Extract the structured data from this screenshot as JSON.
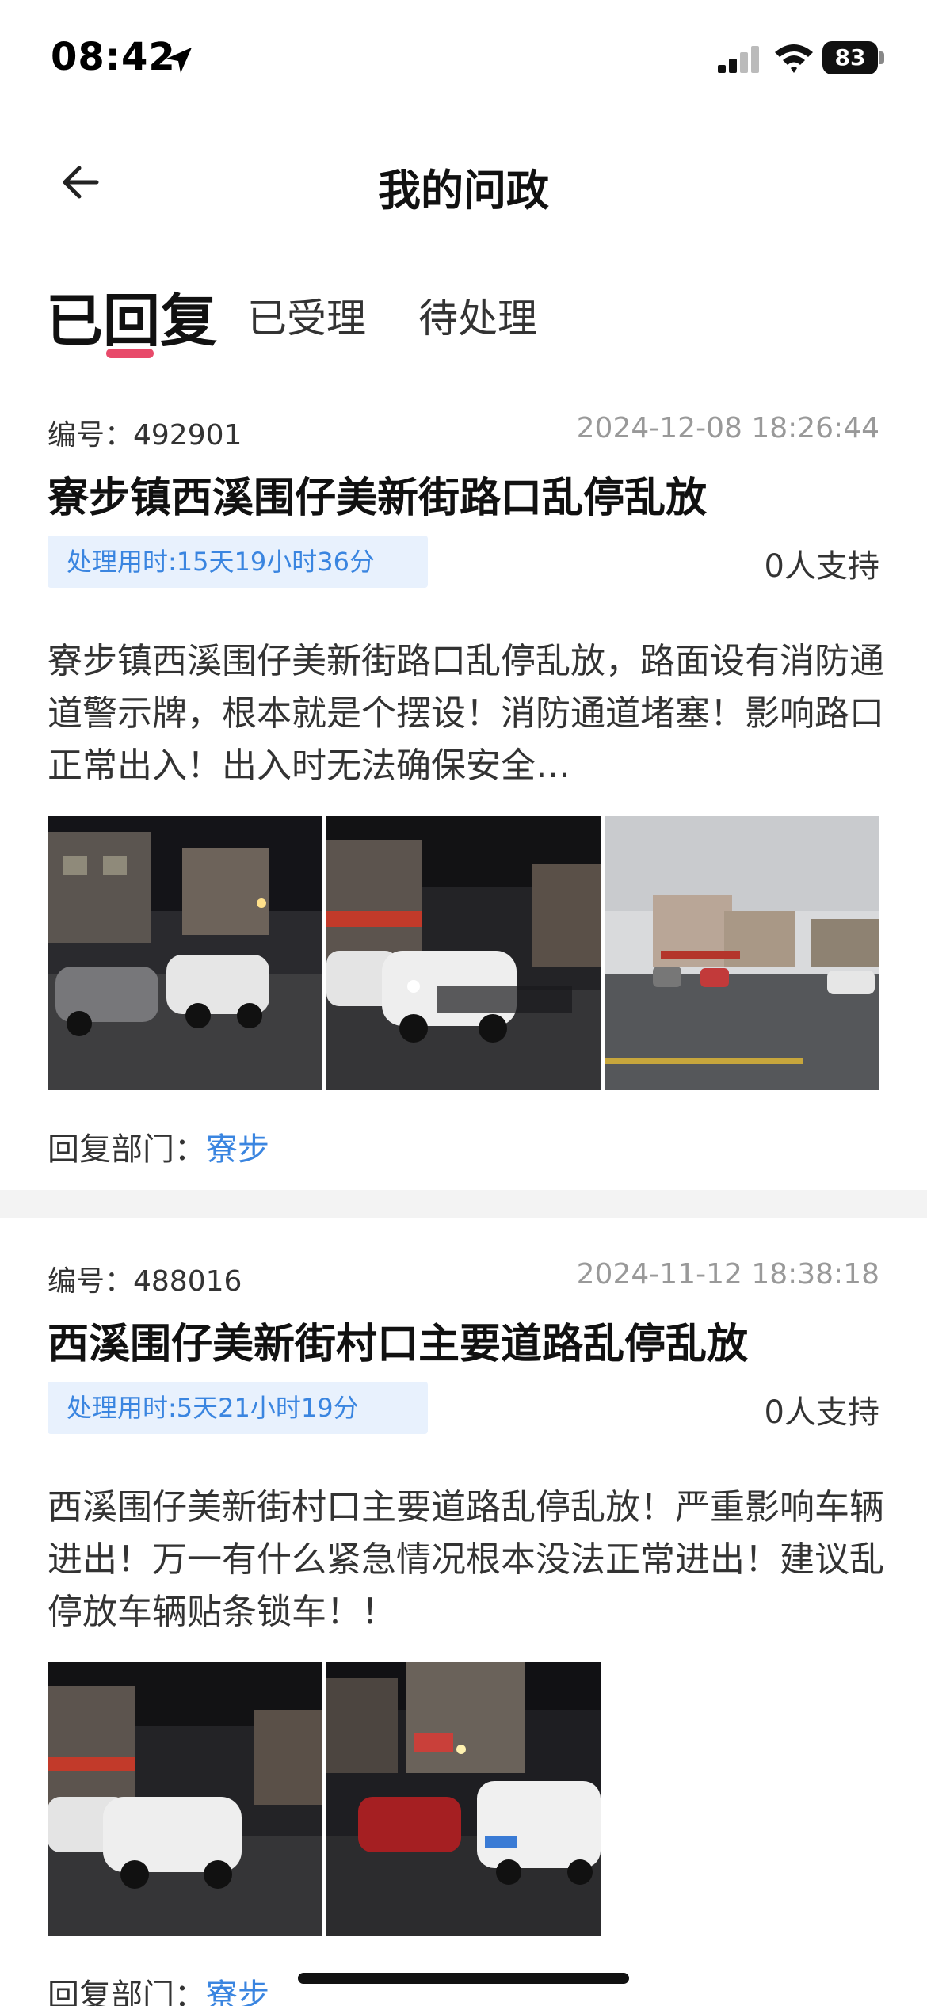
{
  "status_bar": {
    "time": "08:42",
    "battery": "83"
  },
  "nav": {
    "title": "我的问政"
  },
  "tabs": [
    {
      "label": "已回复",
      "active": true
    },
    {
      "label": "已受理",
      "active": false
    },
    {
      "label": "待处理",
      "active": false
    }
  ],
  "colors": {
    "accent": "#3a85e0",
    "tab_indicator": "#e84a6a",
    "badge_bg": "#e8f1fd"
  },
  "cards": [
    {
      "id_label": "编号：492901",
      "time": "2024-12-08 18:26:44",
      "title": "寮步镇西溪围仔美新街路口乱停乱放",
      "duration": "处理用时:15天19小时36分",
      "support": "0人支持",
      "body": "寮步镇西溪围仔美新街路口乱停乱放，路面设有消防通道警示牌，根本就是个摆设！消防通道堵塞！影响路口正常出入！出入时无法确保安全…",
      "photos": [
        "night-street-photo",
        "night-street-photo",
        "day-street-photo"
      ],
      "reply_label": "回复部门：",
      "reply_dept": "寮步"
    },
    {
      "id_label": "编号：488016",
      "time": "2024-11-12 18:38:18",
      "title": "西溪围仔美新街村口主要道路乱停乱放",
      "duration": "处理用时:5天21小时19分",
      "support": "0人支持",
      "body": "西溪围仔美新街村口主要道路乱停乱放！严重影响车辆进出！万一有什么紧急情况根本没法正常进出！建议乱停放车辆贴条锁车！！",
      "photos": [
        "night-street-photo",
        "night-street-photo"
      ],
      "reply_label": "回复部门：",
      "reply_dept": "寮步"
    }
  ]
}
